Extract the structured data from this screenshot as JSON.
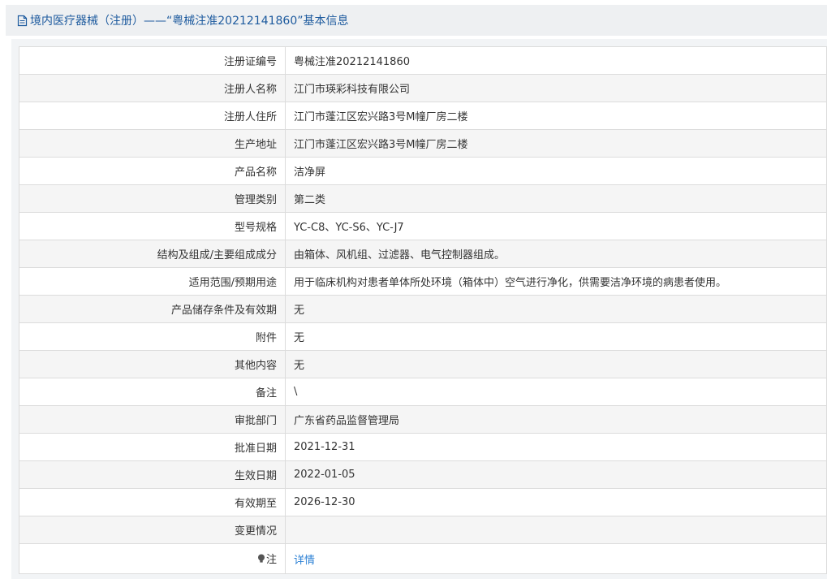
{
  "header": {
    "title": "境内医疗器械（注册）——“粤械注准20212141860”基本信息",
    "icon": "document-icon"
  },
  "rows": [
    {
      "label": "注册证编号",
      "value": "粤械注准20212141860"
    },
    {
      "label": "注册人名称",
      "value": "江门市瑛彩科技有限公司"
    },
    {
      "label": "注册人住所",
      "value": "江门市蓬江区宏兴路3号M幢厂房二楼"
    },
    {
      "label": "生产地址",
      "value": "江门市蓬江区宏兴路3号M幢厂房二楼"
    },
    {
      "label": "产品名称",
      "value": "洁净屏"
    },
    {
      "label": "管理类别",
      "value": "第二类"
    },
    {
      "label": "型号规格",
      "value": "YC-C8、YC-S6、YC-J7"
    },
    {
      "label": "结构及组成/主要组成成分",
      "value": "由箱体、风机组、过滤器、电气控制器组成。"
    },
    {
      "label": "适用范围/预期用途",
      "value": "用于临床机构对患者单体所处环境（箱体中）空气进行净化，供需要洁净环境的病患者使用。"
    },
    {
      "label": "产品储存条件及有效期",
      "value": "无"
    },
    {
      "label": "附件",
      "value": "无"
    },
    {
      "label": "其他内容",
      "value": "无"
    },
    {
      "label": "备注",
      "value": "\\"
    },
    {
      "label": "审批部门",
      "value": "广东省药品监督管理局"
    },
    {
      "label": "批准日期",
      "value": "2021-12-31"
    },
    {
      "label": "生效日期",
      "value": "2022-01-05"
    },
    {
      "label": "有效期至",
      "value": "2026-12-30"
    },
    {
      "label": "变更情况",
      "value": ""
    }
  ],
  "note_row": {
    "label": "注",
    "link": "详情",
    "icon": "lightbulb-icon"
  },
  "colors": {
    "title": "#1d5a9e",
    "link": "#2a7fd4",
    "row_alt": "#f5f5f5",
    "border": "#dcdcdc"
  }
}
